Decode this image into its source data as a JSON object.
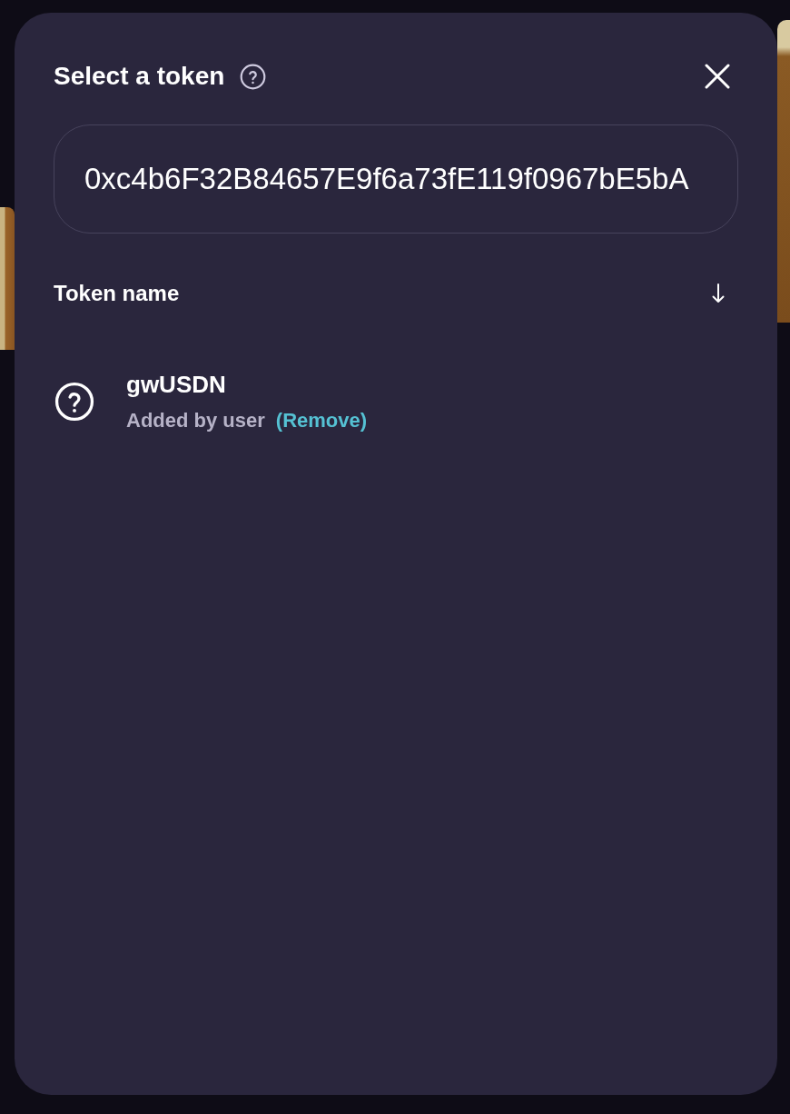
{
  "modal": {
    "title": "Select a token",
    "search": {
      "value": "0xc4b6F32B84657E9f6a73fE119f0967bE5bA"
    },
    "list_header": {
      "label": "Token name"
    },
    "tokens": [
      {
        "symbol": "gwUSDN",
        "source": "Added by user",
        "action": "(Remove)"
      }
    ]
  }
}
